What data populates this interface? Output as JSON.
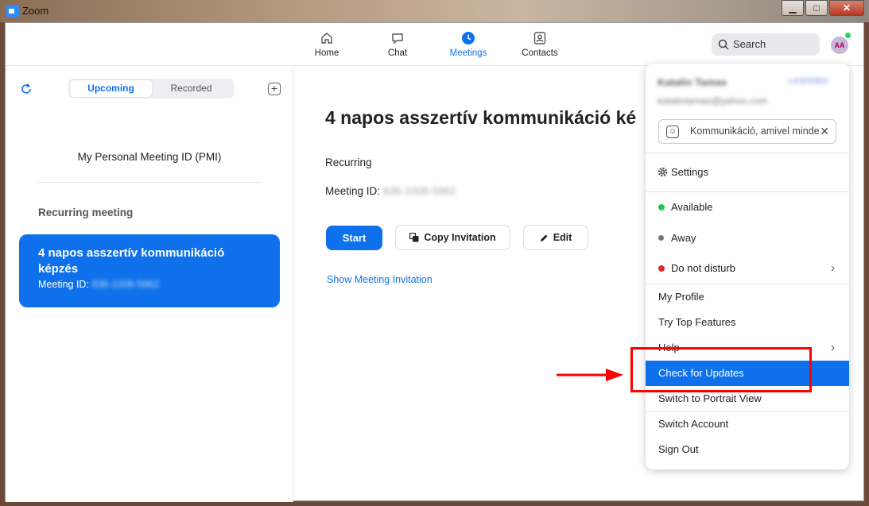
{
  "window": {
    "title": "Zoom",
    "minimize": "▁",
    "maximize": "□",
    "close": "✕"
  },
  "nav": {
    "tabs": [
      {
        "label": "Home",
        "icon": "home-icon"
      },
      {
        "label": "Chat",
        "icon": "chat-icon"
      },
      {
        "label": "Meetings",
        "icon": "clock-icon",
        "active": true
      },
      {
        "label": "Contacts",
        "icon": "contacts-icon"
      }
    ],
    "search_label": "Search",
    "avatar_initials": "AA",
    "accent_color": "#0e71eb"
  },
  "left": {
    "tab_upcoming": "Upcoming",
    "tab_recorded": "Recorded",
    "add_symbol": "+",
    "pmi_label": "My Personal Meeting ID (PMI)",
    "section_header": "Recurring meeting",
    "card": {
      "title": "4 napos asszertív kommunikáció képzés",
      "meeting_id_label": "Meeting ID:",
      "meeting_id_value": "836-1008-5962"
    }
  },
  "main": {
    "title": "4 napos asszertív kommunikáció ké",
    "recurring_label": "Recurring",
    "meeting_id_label": "Meeting ID:",
    "meeting_id_value": "836-1008-5962",
    "start_label": "Start",
    "copy_label": "Copy Invitation",
    "edit_label": "Edit",
    "show_invitation_label": "Show Meeting Invitation"
  },
  "menu": {
    "user_name": "Katalin Tamas",
    "account_badge": "LICENSED",
    "email": "katalintamas@yahoo.com",
    "status_text": "Kommunikáció, amivel minde",
    "clear_symbol": "✕",
    "settings": "Settings",
    "available": "Available",
    "away": "Away",
    "dnd": "Do not disturb",
    "chevron": "›",
    "my_profile": "My Profile",
    "top_features": "Try Top Features",
    "help": "Help",
    "check_updates": "Check for Updates",
    "portrait": "Switch to Portrait View",
    "switch_account": "Switch Account",
    "sign_out": "Sign Out",
    "colors": {
      "available": "#23c552",
      "away": "#777777",
      "dnd": "#e02828"
    }
  }
}
